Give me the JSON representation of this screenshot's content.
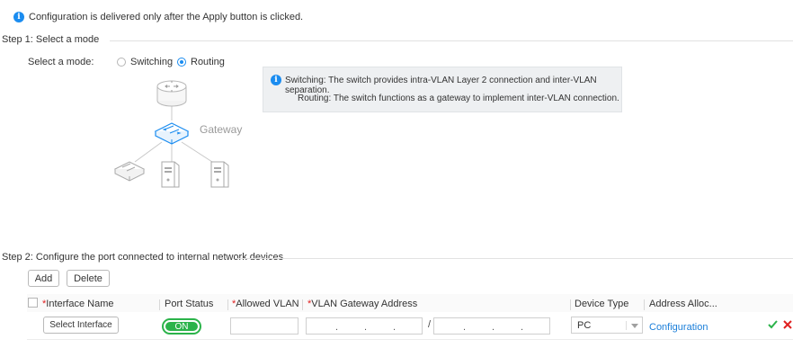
{
  "notice": {
    "text": "Configuration is delivered only after the Apply button is clicked."
  },
  "step1": {
    "title": "Step 1: Select a mode",
    "mode_label": "Select a mode:",
    "options": [
      {
        "label": "Switching",
        "selected": false
      },
      {
        "label": "Routing",
        "selected": true
      }
    ],
    "tip_lines": [
      "Switching: The switch provides intra-VLAN Layer 2 connection and inter-VLAN separation.",
      "Routing: The switch functions as a gateway to implement inter-VLAN connection."
    ],
    "diagram": {
      "gateway_label": "Gateway"
    }
  },
  "step2": {
    "title": "Step 2: Configure the  port connected to internal network devices",
    "buttons": {
      "add": "Add",
      "delete": "Delete"
    },
    "columns": [
      {
        "label": "Interface Name",
        "required": true
      },
      {
        "label": "Port Status",
        "required": false
      },
      {
        "label": "Allowed VLAN",
        "required": true
      },
      {
        "label": "VLAN Gateway Address",
        "required": true
      },
      {
        "label": "Device Type",
        "required": false
      },
      {
        "label": "Address Alloc...",
        "required": false
      }
    ],
    "row": {
      "select_interface": "Select Interface",
      "port_status": "ON",
      "allowed_vlan": "",
      "ip_separator": "/",
      "device_type": "PC",
      "address_alloc": "Configuration"
    }
  },
  "colors": {
    "accent": "#1a8cf0",
    "on_green": "#2bb34a",
    "cancel_red": "#e02020",
    "link": "#1a7ed9"
  }
}
